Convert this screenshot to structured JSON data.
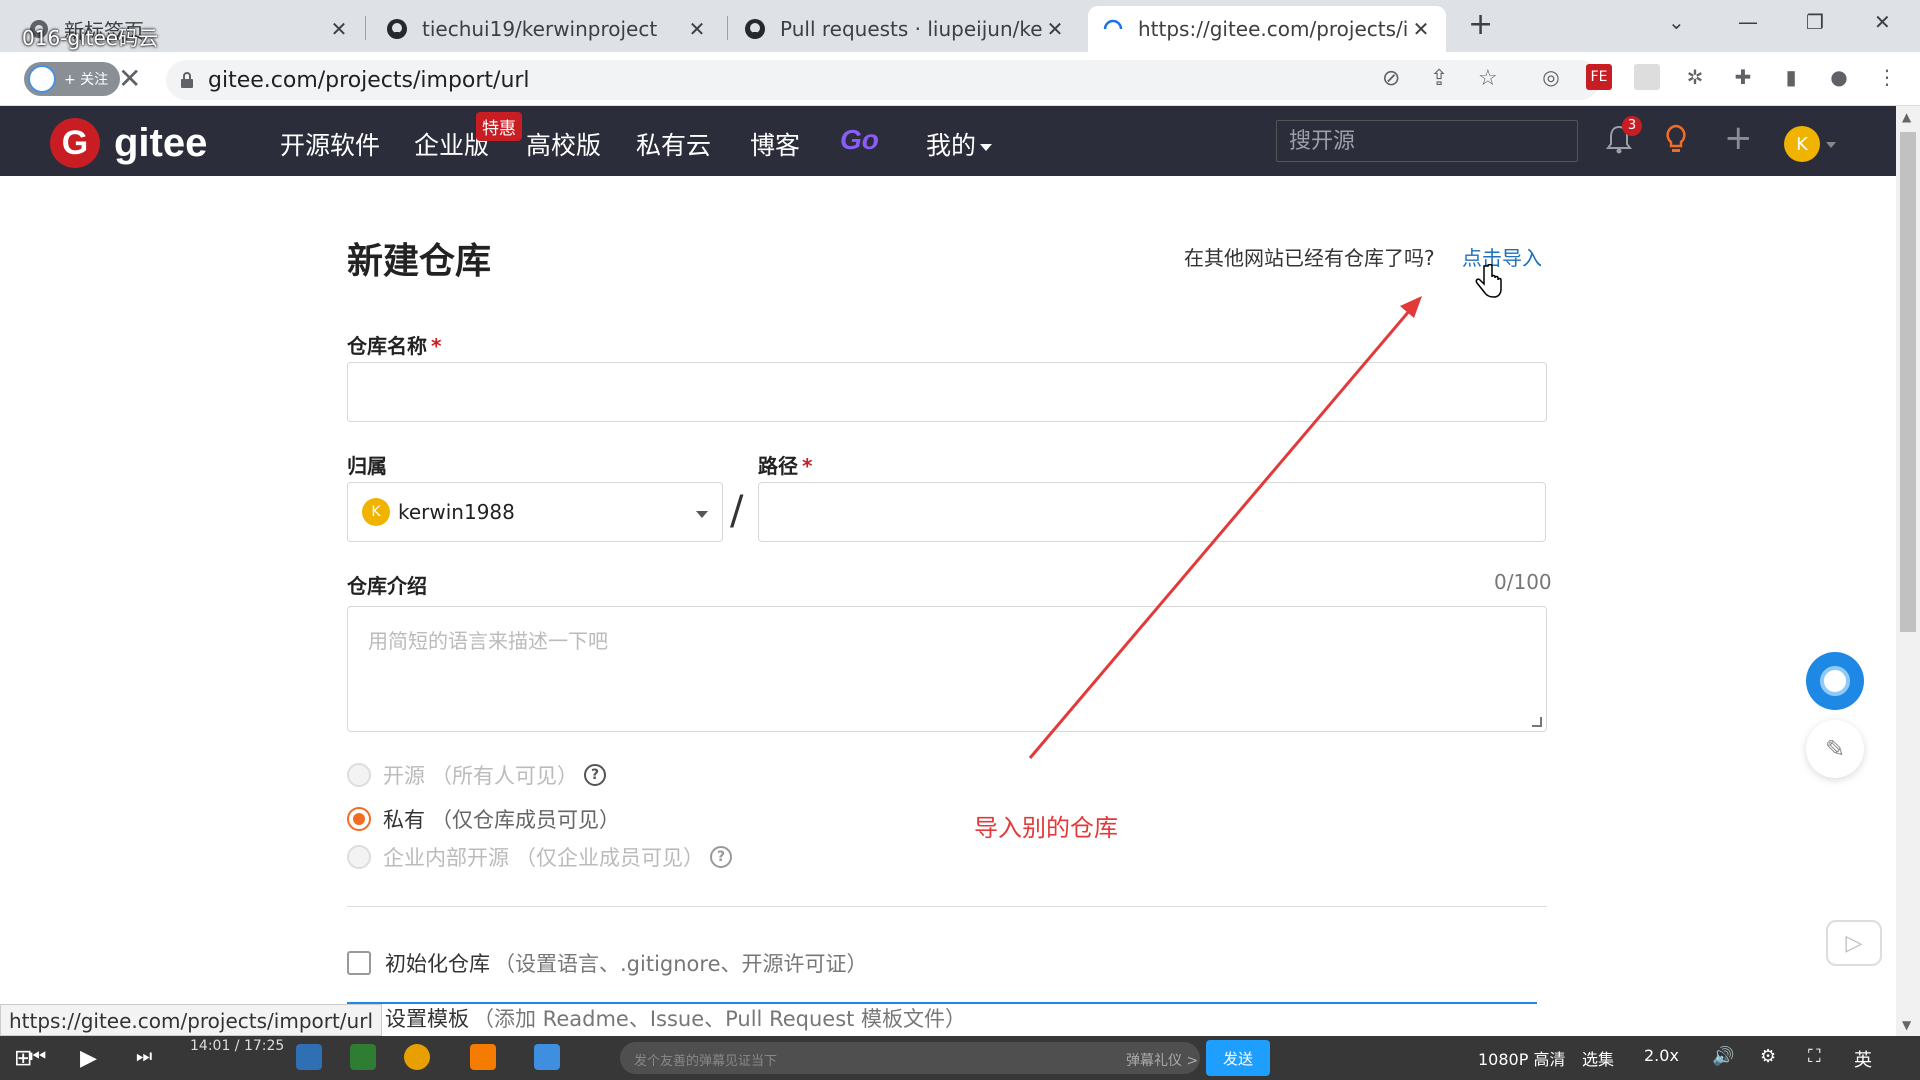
{
  "browser": {
    "overlay_title": "016-gitee码云",
    "tabs": [
      {
        "title": "新标签页",
        "close": "✕"
      },
      {
        "title": "tiechui19/kerwinproject",
        "close": "✕"
      },
      {
        "title": "Pull requests · liupeijun/kerwi",
        "close": "✕"
      },
      {
        "title": "https://gitee.com/projects/im",
        "close": "✕"
      }
    ],
    "new_tab": "+",
    "follow_label": "+ 关注",
    "address": "gitee.com/projects/import/url"
  },
  "gitee_nav": {
    "logo_letter": "G",
    "logo_text": "gitee",
    "menu": [
      "开源软件",
      "企业版",
      "高校版",
      "私有云",
      "博客",
      "Go",
      "我的"
    ],
    "promo_badge": "特惠",
    "search_placeholder": "搜开源",
    "notification_count": "3",
    "user_initial": "K"
  },
  "form": {
    "title": "新建仓库",
    "import_hint": "在其他网站已经有仓库了吗?",
    "import_link": "点击导入",
    "repo_name_label": "仓库名称",
    "required_mark": "*",
    "owner_label": "归属",
    "owner_value": "kerwin1988",
    "owner_initial": "K",
    "path_separator": "/",
    "path_label": "路径",
    "intro_label": "仓库介绍",
    "intro_counter": "0/100",
    "intro_placeholder": "用简短的语言来描述一下吧",
    "visibility": [
      {
        "label": "开源",
        "note": "（所有人可见）",
        "help": "?",
        "state": "disabled"
      },
      {
        "label": "私有",
        "note": "（仅仓库成员可见）",
        "help": "",
        "state": "selected"
      },
      {
        "label": "企业内部开源",
        "note": "（仅企业成员可见）",
        "help": "?",
        "state": "disabled"
      }
    ],
    "init_repo_label": "初始化仓库",
    "init_repo_note": "（设置语言、.gitignore、开源许可证）",
    "template_label": "设置模板",
    "template_note": "（添加 Readme、Issue、Pull Request 模板文件）"
  },
  "annotation": {
    "text": "导入别的仓库",
    "color": "#e23a3a"
  },
  "status_bar_url": "https://gitee.com/projects/import/url",
  "player": {
    "time": "14:01 / 17:25",
    "danmaku_placeholder": "发个友善的弹幕见证当下",
    "gift": "弹幕礼仪 >",
    "send": "发送",
    "quality": "1080P 高清",
    "episodes": "选集",
    "speed": "2.0x",
    "ime": "英"
  },
  "colors": {
    "gitee_red": "#c71d23",
    "nav_bg": "#2b2d3a",
    "radio_accent": "#f36c21",
    "link": "#1e6fbd"
  }
}
